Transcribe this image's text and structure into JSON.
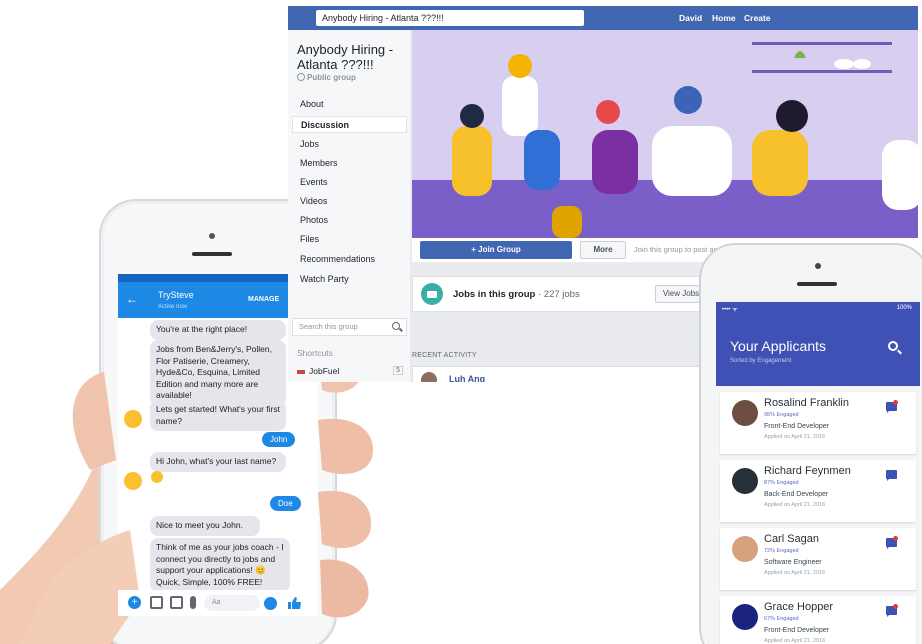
{
  "colors": {
    "fb_blue": "#4267b2",
    "messenger_blue": "#1e88e5",
    "app_indigo": "#3f51b5",
    "notify_red": "#e53935"
  },
  "facebook": {
    "search_text": "Anybody Hiring - Atlanta ???!!!",
    "nav": {
      "user": "David",
      "home": "Home",
      "create": "Create"
    },
    "group_title": "Anybody Hiring - Atlanta ???!!!",
    "privacy": "Public group",
    "menu": [
      "About",
      "Discussion",
      "Jobs",
      "Members",
      "Events",
      "Videos",
      "Photos",
      "Files",
      "Recommendations",
      "Watch Party"
    ],
    "active_menu": "Discussion",
    "search_placeholder": "Search this group",
    "shortcuts_label": "Shortcuts",
    "shortcut_item": {
      "label": "JobFuel",
      "count": "5"
    },
    "join_button": "+ Join Group",
    "more_button": "More",
    "join_hint": "Join this group to post and comment",
    "jobs": {
      "title": "Jobs in this group",
      "count": "· 227 jobs",
      "button": "View Jobs"
    },
    "recent_activity": "RECENT ACTIVITY",
    "recent_poster": "Luh Ang"
  },
  "messenger": {
    "status_time": "",
    "contact_name": "TrySteve",
    "contact_status": "Active now",
    "manage": "MANAGE",
    "messages": {
      "m1": "You're at the right place!",
      "m2": "Jobs from Ben&Jerry's, Pollen, Flor Patiserie, Creamery, Hyde&Co, Esquina, Limited Edition and many more are available!",
      "m3": "Lets get started!  What's your first name?",
      "m4": "John",
      "m5": "Hi John, what's your last name?",
      "m6": "Doe",
      "m7": "Nice to meet you John.",
      "m8": "Think of me as your jobs coach - I connect you directly to jobs and support your applications! 😊 Quick, Simple, 100% FREE!"
    },
    "input_placeholder": "Aa",
    "icons": [
      "plus-icon",
      "camera-icon",
      "image-icon",
      "mic-icon",
      "emoji-icon",
      "thumbs-up-icon"
    ]
  },
  "applicant_app": {
    "carrier": "•••• ᯤ",
    "battery": "100%",
    "title": "Your Applicants",
    "subtitle": "Sorted by Engagement",
    "applicants": [
      {
        "name": "Rosalind Franklin",
        "engaged": "95% Engaged",
        "role": "Front-End Developer",
        "applied": "Applied on April 21, 2016",
        "avatar_color": "#6d4c41",
        "unread": true
      },
      {
        "name": "Richard Feynmen",
        "engaged": "87% Engaged",
        "role": "Back-End Developer",
        "applied": "Applied on April 21, 2016",
        "avatar_color": "#263238",
        "unread": false
      },
      {
        "name": "Carl Sagan",
        "engaged": "72% Engaged",
        "role": "Software Engineer",
        "applied": "Applied on April 21, 2016",
        "avatar_color": "#d7a17c",
        "unread": true
      },
      {
        "name": "Grace Hopper",
        "engaged": "67% Engaged",
        "role": "Front-End Developer",
        "applied": "Applied on April 21, 2016",
        "avatar_color": "#1a237e",
        "unread": true
      }
    ]
  }
}
